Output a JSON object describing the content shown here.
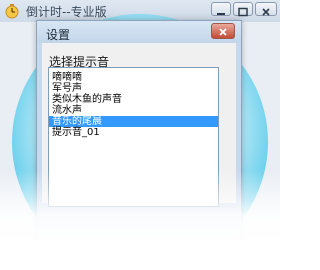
{
  "main_window": {
    "title": "倒计时--专业版",
    "icons": {
      "app": "app-icon",
      "minimize": "minimize-icon",
      "maximize": "maximize-icon",
      "close": "close-icon"
    }
  },
  "dialog": {
    "title": "设置",
    "section_label": "选择提示音",
    "close_icon": "close-icon",
    "sounds": [
      {
        "label": "嘀嘀嘀",
        "selected": false
      },
      {
        "label": "军号声",
        "selected": false
      },
      {
        "label": "类似木鱼的声音",
        "selected": false
      },
      {
        "label": "流水声",
        "selected": false
      },
      {
        "label": "音乐的尾晨",
        "selected": true
      },
      {
        "label": "提示音_01",
        "selected": false
      }
    ]
  },
  "colors": {
    "selection": "#3399ff",
    "accent_circle": "#3bbbe2",
    "dialog_close": "#c44a35"
  }
}
